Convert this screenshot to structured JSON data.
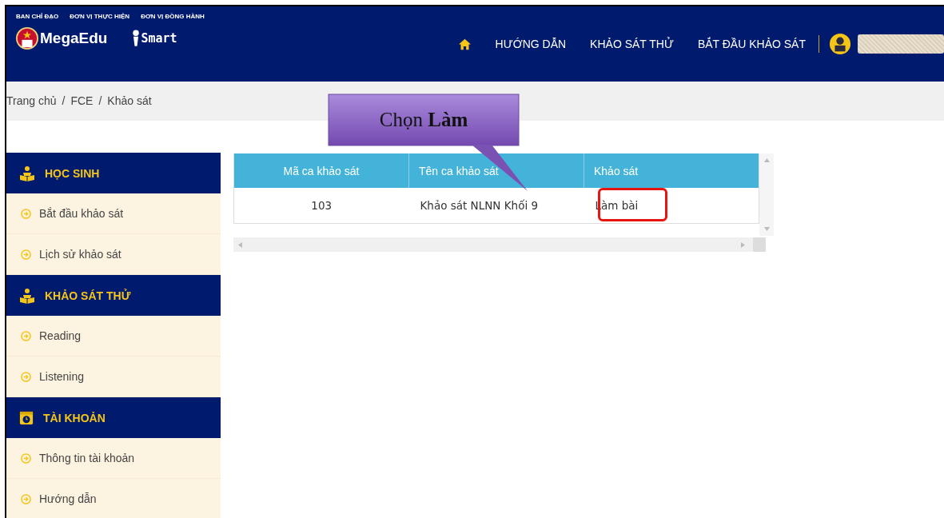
{
  "header": {
    "partner_labels": [
      "BAN CHỈ ĐẠO",
      "ĐƠN VỊ THỰC HIỆN",
      "ĐƠN VỊ ĐỒNG HÀNH"
    ],
    "logos": [
      {
        "kind": "megaedu",
        "text": "MegaEdu"
      },
      {
        "kind": "smart",
        "text": "Smart"
      }
    ],
    "nav": [
      "HƯỚNG DẪN",
      "KHẢO SÁT THỬ",
      "BẮT ĐẦU KHẢO SÁT"
    ]
  },
  "breadcrumb": {
    "separator": "/",
    "items": [
      "Trang chủ",
      "FCE",
      "Khảo sát"
    ]
  },
  "sidebar": {
    "sections": [
      {
        "title": "HỌC SINH",
        "kind": "student",
        "items": [
          "Bắt đầu khảo sát",
          "Lịch sử khảo sát"
        ]
      },
      {
        "title": "KHẢO SÁT THỬ",
        "kind": "student",
        "items": [
          "Reading",
          "Listening"
        ]
      },
      {
        "title": "TÀI KHOẢN",
        "kind": "account",
        "items": [
          "Thông tin tài khoản",
          "Hướng dẫn"
        ]
      }
    ]
  },
  "table": {
    "columns": [
      "Mã ca khảo sát",
      "Tên ca khảo sát",
      "Khảo sát"
    ],
    "rows": [
      {
        "cells": [
          {
            "text": "103",
            "highlighted": false
          },
          {
            "text": "Khảo sát NLNN Khối 9",
            "highlighted": false
          },
          {
            "text": "Làm bài",
            "highlighted": true
          }
        ]
      }
    ]
  },
  "callout": {
    "text": "Chọn **Làm**"
  }
}
